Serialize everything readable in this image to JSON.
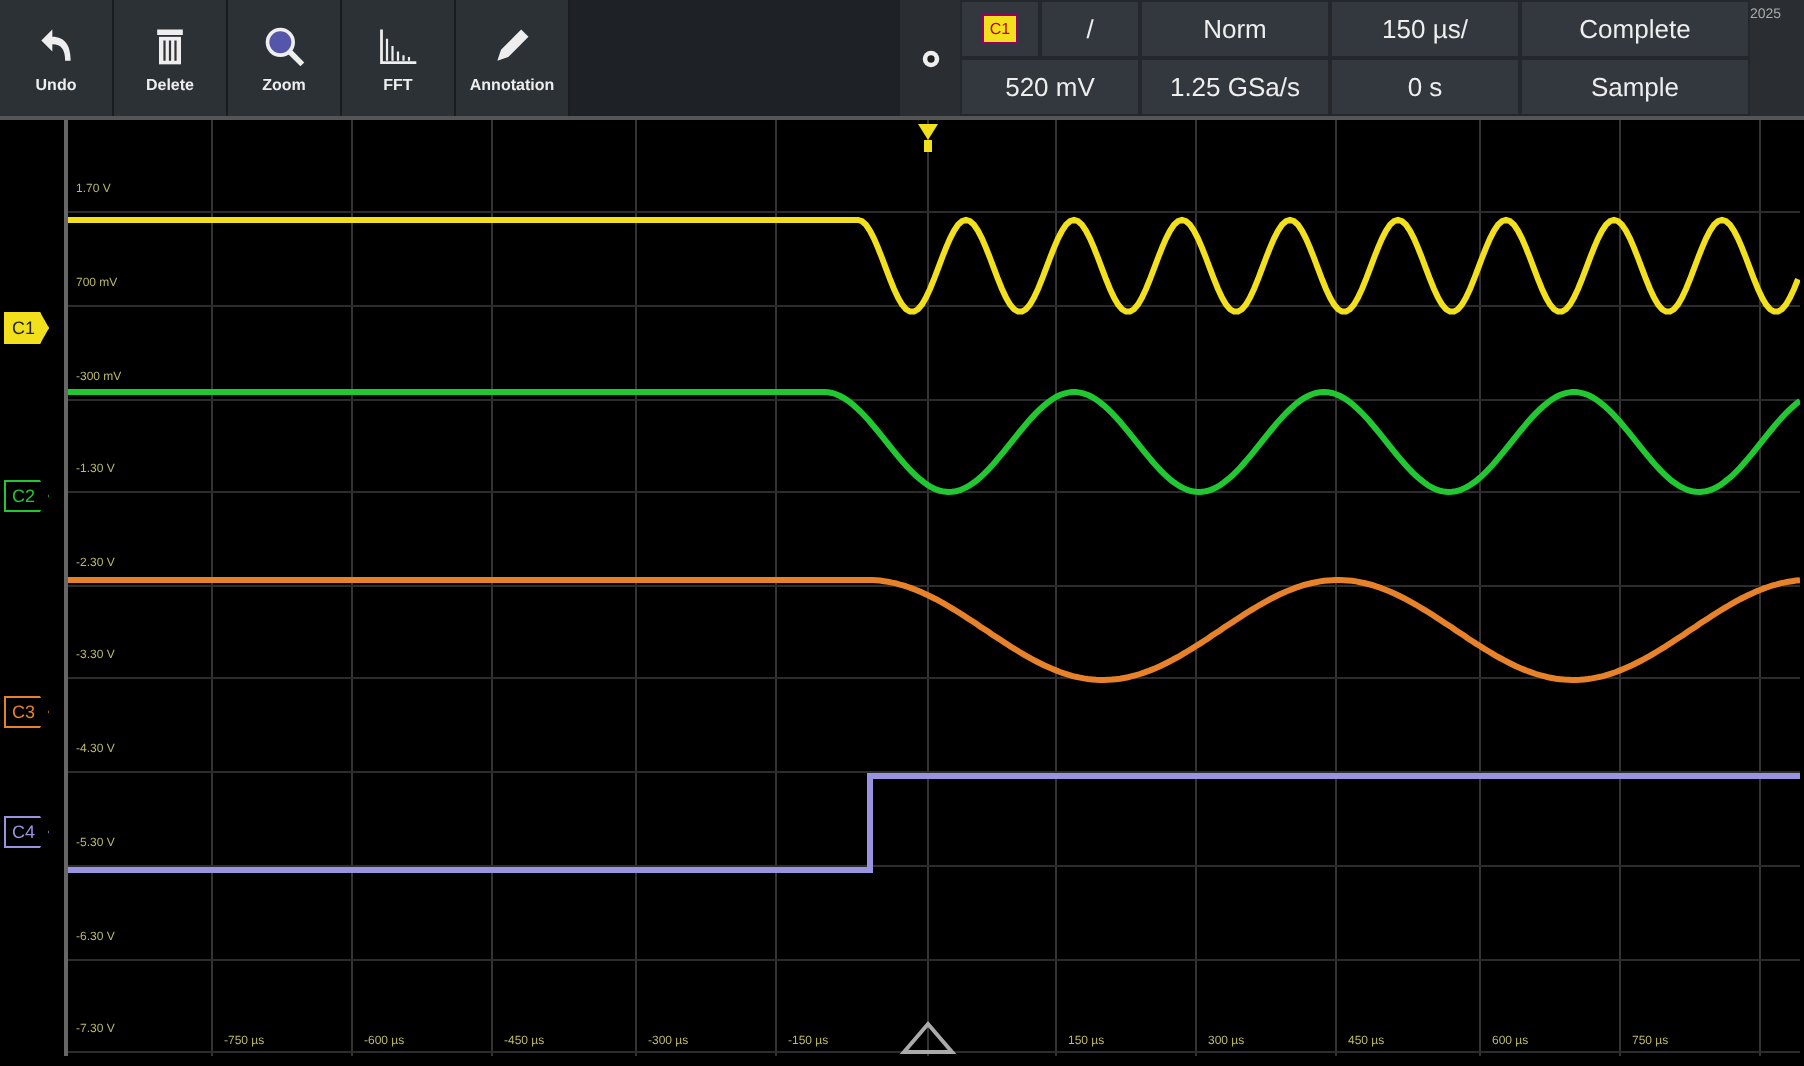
{
  "toolbar": {
    "buttons": [
      {
        "label": "Undo",
        "kind": "undo"
      },
      {
        "label": "Delete",
        "kind": "delete"
      },
      {
        "label": "Zoom",
        "kind": "zoom"
      },
      {
        "label": "FFT",
        "kind": "fft"
      },
      {
        "label": "Annotation",
        "kind": "annotation"
      }
    ]
  },
  "trigger_panel": {
    "source": "C1",
    "slope": "/",
    "mode": "Norm",
    "timebase": "150 µs/",
    "acquisition": "Complete",
    "level": "520 mV",
    "sample_rate": "1.25 GSa/s",
    "delay": "0 s",
    "acq_mode": "Sample"
  },
  "corner_text": "2025",
  "channels": [
    {
      "label": "C1",
      "color": "#f2e01c",
      "selected": true
    },
    {
      "label": "C2",
      "color": "#22c832",
      "selected": false
    },
    {
      "label": "C3",
      "color": "#e8822a",
      "selected": false
    },
    {
      "label": "C4",
      "color": "#9a94e0",
      "selected": false
    }
  ],
  "y_labels": [
    "1.70 V",
    "700 mV",
    "-300 mV",
    "-1.30 V",
    "-2.30 V",
    "-3.30 V",
    "-4.30 V",
    "-5.30 V",
    "-6.30 V",
    "-7.30 V"
  ],
  "x_labels": [
    "-750 µs",
    "-600 µs",
    "-450 µs",
    "-300 µs",
    "-150 µs",
    "150 µs",
    "300 µs",
    "450 µs",
    "600 µs",
    "750 µs"
  ]
}
